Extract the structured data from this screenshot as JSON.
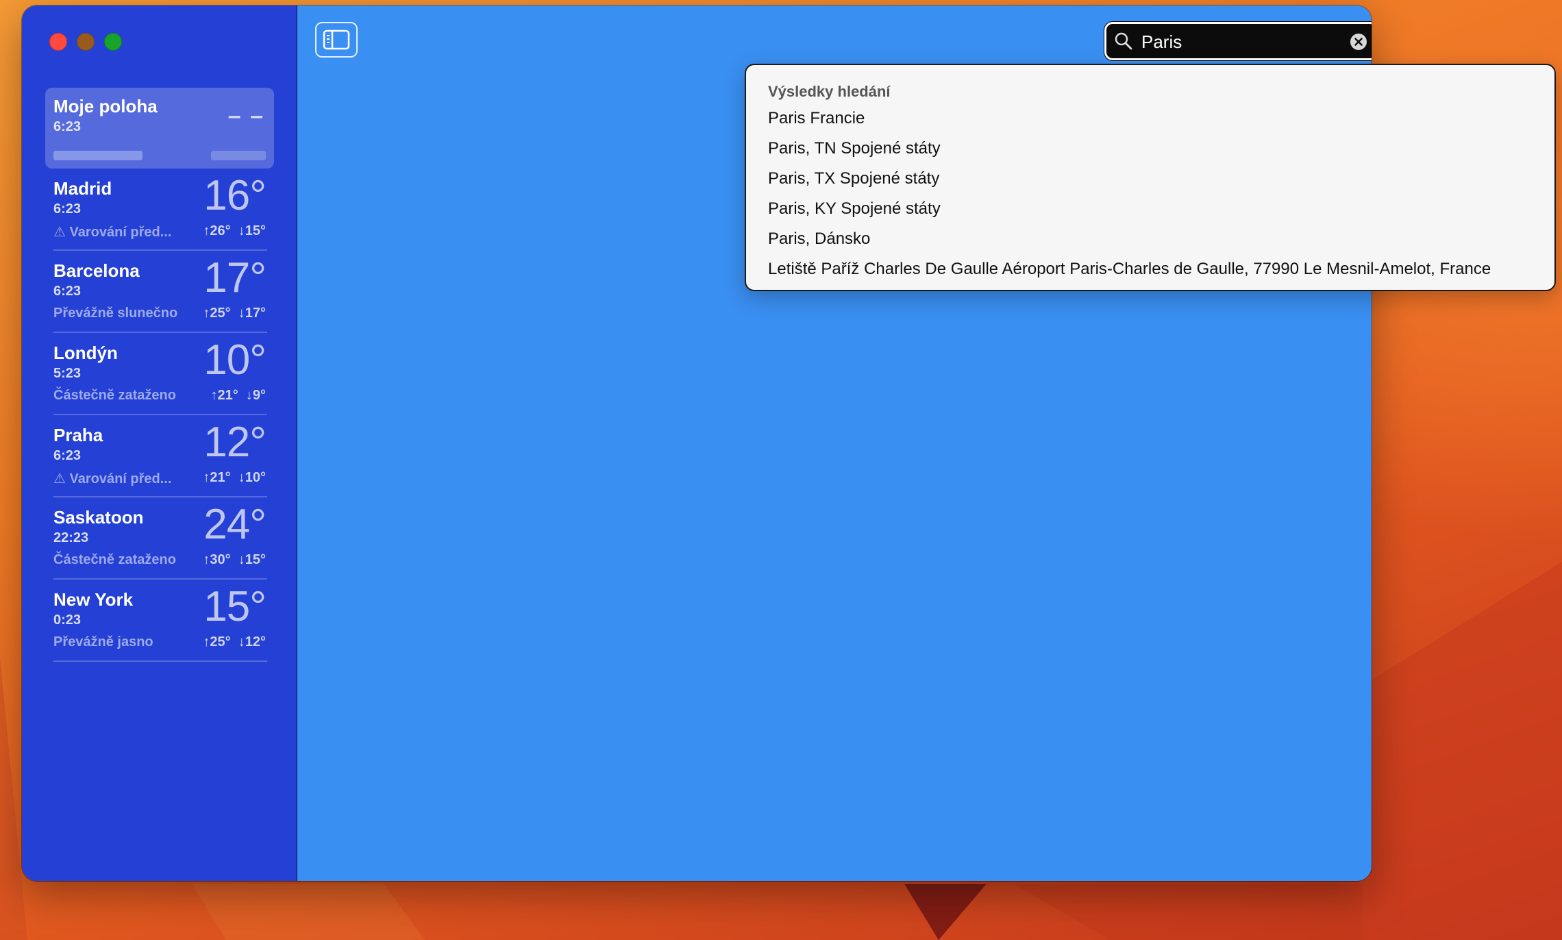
{
  "sidebar": {
    "locations": [
      {
        "name": "Moje poloha",
        "time": "6:23",
        "temp": "– –",
        "condition": "",
        "high": "",
        "low": ""
      },
      {
        "name": "Madrid",
        "time": "6:23",
        "temp": "16°",
        "condition": "Varování před...",
        "high": "↑26°",
        "low": "↓15°",
        "warning": true
      },
      {
        "name": "Barcelona",
        "time": "6:23",
        "temp": "17°",
        "condition": "Převážně slunečno",
        "high": "↑25°",
        "low": "↓17°"
      },
      {
        "name": "Londýn",
        "time": "5:23",
        "temp": "10°",
        "condition": "Částečně zataženo",
        "high": "↑21°",
        "low": "↓9°"
      },
      {
        "name": "Praha",
        "time": "6:23",
        "temp": "12°",
        "condition": "Varování před...",
        "high": "↑21°",
        "low": "↓10°",
        "warning": true
      },
      {
        "name": "Saskatoon",
        "time": "22:23",
        "temp": "24°",
        "condition": "Částečně zataženo",
        "high": "↑30°",
        "low": "↓15°"
      },
      {
        "name": "New York",
        "time": "0:23",
        "temp": "15°",
        "condition": "Převážně jasno",
        "high": "↑25°",
        "low": "↓12°"
      }
    ]
  },
  "toolbar": {
    "sidebar_toggle_icon": "sidebar-toggle-icon"
  },
  "search": {
    "value": "Paris",
    "icon": "search-icon",
    "clear_icon": "clear-icon"
  },
  "results": {
    "header": "Výsledky hledání",
    "items": [
      "Paris Francie",
      "Paris, TN Spojené státy",
      "Paris, TX Spojené státy",
      "Paris, KY Spojené státy",
      "Paris, Dánsko",
      "Letiště Paříž Charles De Gaulle Aéroport Paris-Charles de Gaulle, 77990 Le Mesnil-Amelot, France"
    ]
  },
  "colors": {
    "sidebar": "#2540d4",
    "main": "#3a8ff2",
    "close": "#ff4a3f",
    "minimize": "#9a5a1e",
    "zoom": "#18a32a"
  }
}
